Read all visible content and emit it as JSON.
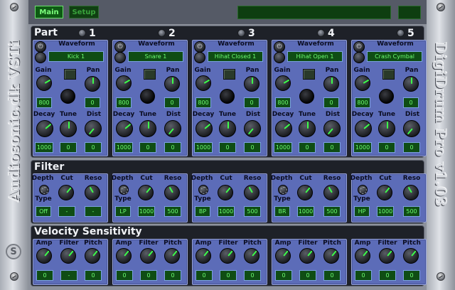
{
  "brand": {
    "left_text": "Audiosonic.dk VSTi",
    "right_text": "DigiDrum Pro v1.03",
    "logo_glyph": "S"
  },
  "tabs": [
    {
      "label": "Main",
      "active": true
    },
    {
      "label": "Setup",
      "active": false
    }
  ],
  "sections": {
    "part": "Part",
    "filter": "Filter",
    "velocity": "Velocity Sensitivity"
  },
  "labels": {
    "waveform": "Waveform",
    "gain": "Gain",
    "pan": "Pan",
    "decay": "Decay",
    "tune": "Tune",
    "dist": "Dist",
    "depth": "Depth",
    "cut": "Cut",
    "reso": "Reso",
    "type": "Type",
    "amp": "Amp",
    "filter": "Filter",
    "pitch": "Pitch",
    "power_glyph": "⏻"
  },
  "parts": [
    {
      "number": "1",
      "waveform": "Kick 1",
      "gain": "800",
      "pan": "0",
      "decay": "1000",
      "tune": "0",
      "dist": "0",
      "f_type": "Off",
      "f_cut": "-",
      "f_reso": "-",
      "v_amp": "0",
      "v_filter": "-",
      "v_pitch": "0"
    },
    {
      "number": "2",
      "waveform": "Snare 1",
      "gain": "800",
      "pan": "0",
      "decay": "1000",
      "tune": "0",
      "dist": "0",
      "f_type": "LP",
      "f_cut": "1000",
      "f_reso": "500",
      "v_amp": "0",
      "v_filter": "0",
      "v_pitch": "0"
    },
    {
      "number": "3",
      "waveform": "Hihat Closed 1",
      "gain": "800",
      "pan": "0",
      "decay": "1000",
      "tune": "0",
      "dist": "0",
      "f_type": "BP",
      "f_cut": "1000",
      "f_reso": "500",
      "v_amp": "0",
      "v_filter": "0",
      "v_pitch": "0"
    },
    {
      "number": "4",
      "waveform": "Hihat Open 1",
      "gain": "800",
      "pan": "0",
      "decay": "1000",
      "tune": "0",
      "dist": "0",
      "f_type": "BR",
      "f_cut": "1000",
      "f_reso": "500",
      "v_amp": "0",
      "v_filter": "0",
      "v_pitch": "0"
    },
    {
      "number": "5",
      "waveform": "Crash Cymbal",
      "gain": "800",
      "pan": "0",
      "decay": "1000",
      "tune": "0",
      "dist": "0",
      "f_type": "HP",
      "f_cut": "1000",
      "f_reso": "500",
      "v_amp": "0",
      "v_filter": "0",
      "v_pitch": "0"
    }
  ]
}
